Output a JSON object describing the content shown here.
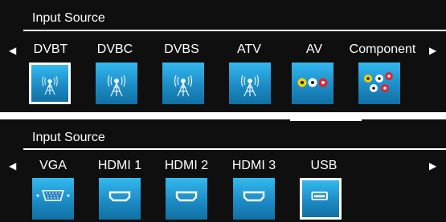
{
  "panel1": {
    "title": "Input Source",
    "left_arrow": "◀",
    "right_arrow": "▶",
    "sources": [
      {
        "label": "DVBT",
        "icon": "antenna-icon",
        "selected": true
      },
      {
        "label": "DVBC",
        "icon": "antenna-icon",
        "selected": false
      },
      {
        "label": "DVBS",
        "icon": "antenna-icon",
        "selected": false
      },
      {
        "label": "ATV",
        "icon": "antenna-icon",
        "selected": false
      },
      {
        "label": "AV",
        "icon": "rca-av-icon",
        "selected": false
      },
      {
        "label": "Component",
        "icon": "rca-component-icon",
        "selected": false
      }
    ]
  },
  "panel2": {
    "title": "Input Source",
    "left_arrow": "◀",
    "right_arrow": "▶",
    "sources": [
      {
        "label": "VGA",
        "icon": "vga-port-icon",
        "selected": false
      },
      {
        "label": "HDMI 1",
        "icon": "hdmi-port-icon",
        "selected": false
      },
      {
        "label": "HDMI 2",
        "icon": "hdmi-port-icon",
        "selected": false
      },
      {
        "label": "HDMI 3",
        "icon": "hdmi-port-icon",
        "selected": false
      },
      {
        "label": "USB",
        "icon": "usb-port-icon",
        "selected": true
      }
    ]
  },
  "colors": {
    "panel_bg": "#0f0f0f",
    "tile_top": "#33b9ef",
    "tile_bottom": "#1170a3",
    "selection_border": "#ffffff",
    "text": "#ffffff"
  }
}
